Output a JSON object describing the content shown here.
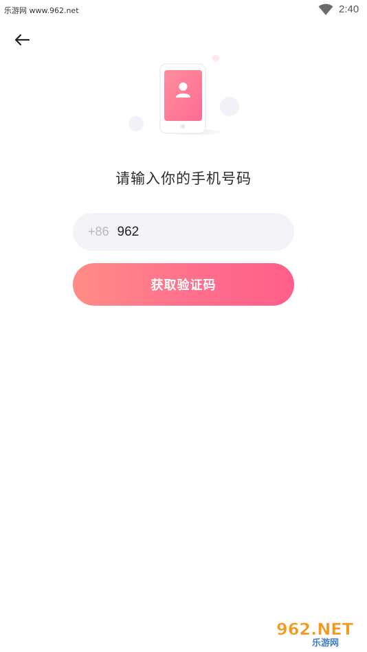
{
  "status_bar": {
    "watermark": "乐游网 www.962.net",
    "time": "2:40"
  },
  "page": {
    "title": "请输入你的手机号码"
  },
  "phone_input": {
    "country_code": "+86",
    "value": "962"
  },
  "actions": {
    "get_code_label": "获取验证码"
  },
  "watermark_logo": {
    "big": "962.NET",
    "small": "乐游网"
  },
  "icons": {
    "back": "arrow-left-icon",
    "wifi": "wifi-icon",
    "user": "user-icon"
  },
  "colors": {
    "accent_start": "#ff8c86",
    "accent_end": "#ff5e8a",
    "input_bg": "#f4f4f8",
    "prefix_text": "#b7b5c6"
  }
}
